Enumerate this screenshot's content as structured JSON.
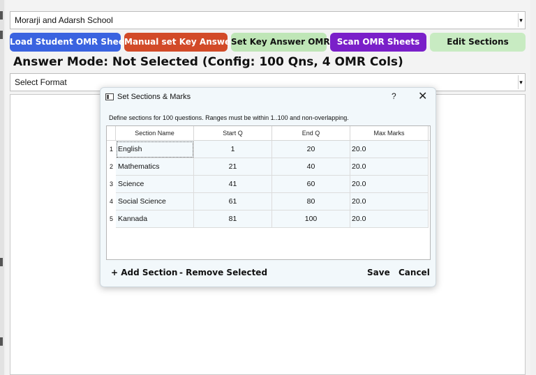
{
  "app": {
    "school_select": {
      "value": "Morarji and Adarsh School"
    },
    "toolbar": {
      "load_label": "Load Student OMR Sheets",
      "manual_key_label": "Manual set Key Answer",
      "set_key_label": "Set Key Answer OMR",
      "scan_label": "Scan OMR Sheets",
      "edit_sections_label": "Edit Sections"
    },
    "mode_text": "Answer Mode: Not Selected (Config: 100 Qns, 4 OMR Cols)",
    "format_select": {
      "value": "Select Format"
    }
  },
  "dialog": {
    "title": "Set Sections & Marks",
    "help_label": "?",
    "close_label": "✕",
    "description": "Define sections for 100 questions. Ranges must be within 1..100 and non-overlapping.",
    "table": {
      "headers": [
        "Section Name",
        "Start Q",
        "End Q",
        "Max Marks"
      ],
      "rows": [
        {
          "num": "1",
          "name": "English",
          "start": "1",
          "end": "20",
          "max": "20.0"
        },
        {
          "num": "2",
          "name": "Mathematics",
          "start": "21",
          "end": "40",
          "max": "20.0"
        },
        {
          "num": "3",
          "name": "Science",
          "start": "41",
          "end": "60",
          "max": "20.0"
        },
        {
          "num": "4",
          "name": "Social Science",
          "start": "61",
          "end": "80",
          "max": "20.0"
        },
        {
          "num": "5",
          "name": "Kannada",
          "start": "81",
          "end": "100",
          "max": "20.0"
        }
      ]
    },
    "add_label": "+ Add Section",
    "remove_label": "- Remove Selected",
    "save_label": "Save",
    "cancel_label": "Cancel"
  },
  "colors": {
    "load": "#3a63e0",
    "manual_key": "#d24a28",
    "set_key": "#bfe6b7",
    "scan": "#7a1fc9",
    "edit_sections": "#c8ebc2"
  }
}
